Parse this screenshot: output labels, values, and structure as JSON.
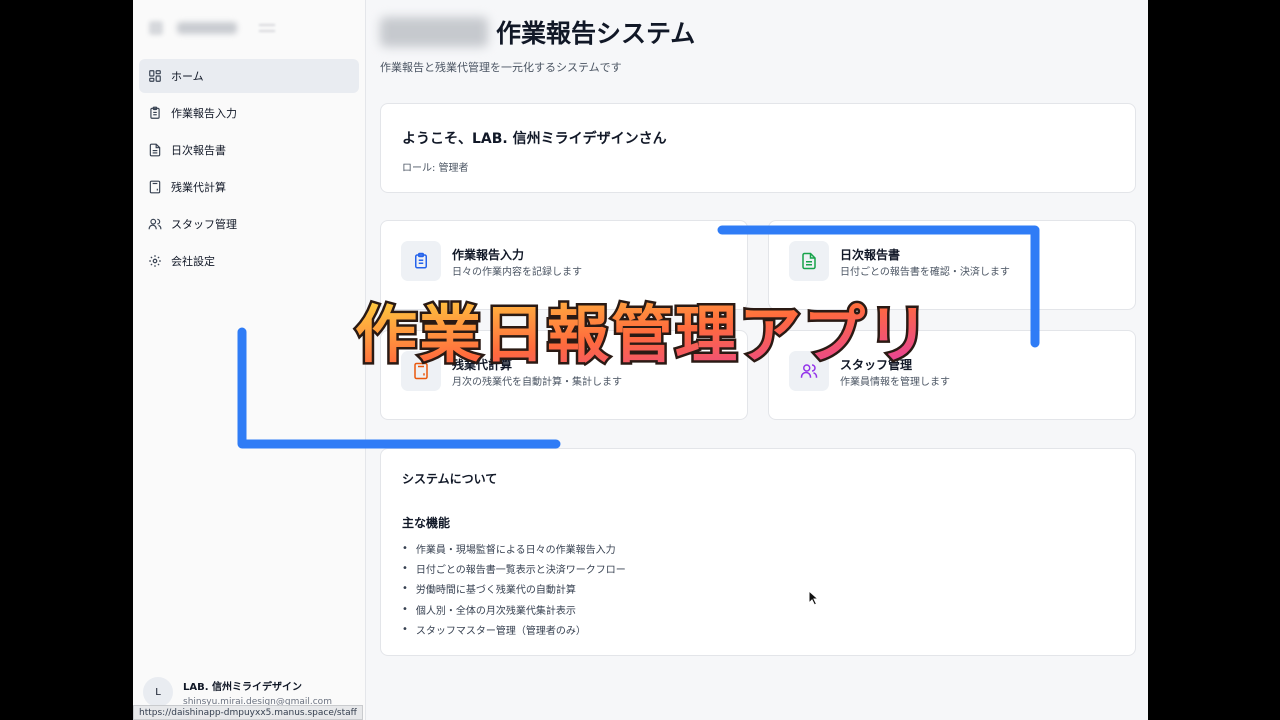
{
  "sidebar": {
    "items": [
      {
        "label": "ホーム",
        "icon": "dashboard-icon",
        "active": true
      },
      {
        "label": "作業報告入力",
        "icon": "clipboard-icon"
      },
      {
        "label": "日次報告書",
        "icon": "file-text-icon"
      },
      {
        "label": "残業代計算",
        "icon": "calculator-icon"
      },
      {
        "label": "スタッフ管理",
        "icon": "users-icon"
      },
      {
        "label": "会社設定",
        "icon": "gear-icon"
      }
    ],
    "user": {
      "initial": "L",
      "name": "LAB. 信州ミライデザイン",
      "email": "shinsyu.mirai.design@gmail.com"
    }
  },
  "header": {
    "title": "作業報告システム",
    "subtitle": "作業報告と残業代管理を一元化するシステムです"
  },
  "welcome": {
    "title": "ようこそ、LAB. 信州ミライデザインさん",
    "role": "ロール: 管理者"
  },
  "features": [
    {
      "title": "作業報告入力",
      "desc": "日々の作業内容を記録します",
      "icon": "clipboard-icon",
      "color": "#2563eb"
    },
    {
      "title": "日次報告書",
      "desc": "日付ごとの報告書を確認・決済します",
      "icon": "file-text-icon",
      "color": "#16a34a"
    },
    {
      "title": "残業代計算",
      "desc": "月次の残業代を自動計算・集計します",
      "icon": "calculator-icon",
      "color": "#ea580c"
    },
    {
      "title": "スタッフ管理",
      "desc": "作業員情報を管理します",
      "icon": "users-icon",
      "color": "#9333ea"
    }
  ],
  "about": {
    "title": "システムについて",
    "subtitle": "主な機能",
    "items": [
      "作業員・現場監督による日々の作業報告入力",
      "日付ごとの報告書一覧表示と決済ワークフロー",
      "労働時間に基づく残業代の自動計算",
      "個人別・全体の月次残業代集計表示",
      "スタッフマスター管理（管理者のみ）"
    ]
  },
  "status_url": "https://daishinapp-dmpuyxx5.manus.space/staff",
  "overlay": {
    "caption": "作業日報管理アプリ",
    "accent": "#2f7cf6"
  }
}
